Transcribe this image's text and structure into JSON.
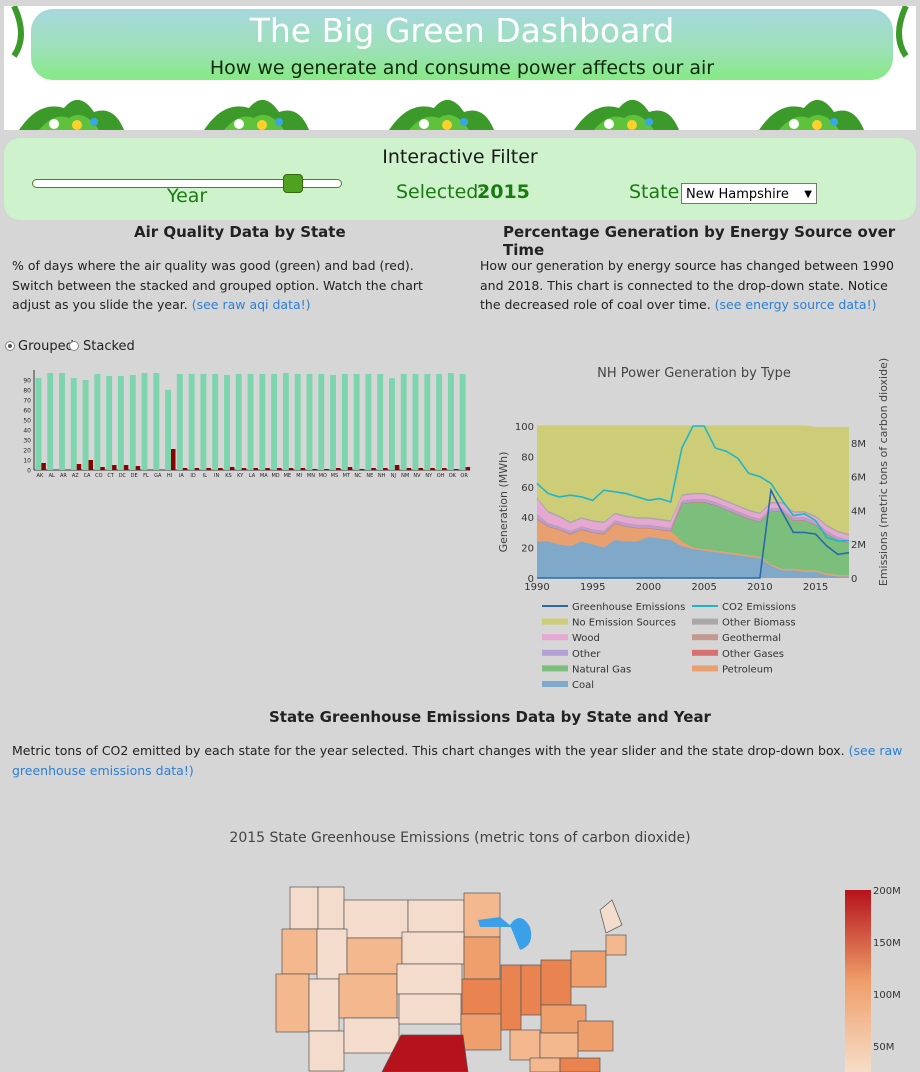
{
  "header": {
    "title": "The Big Green Dashboard",
    "subtitle": "How we generate and consume power affects our air"
  },
  "filter": {
    "title": "Interactive Filter",
    "slider_label": "Year",
    "slider_value": 2015,
    "slider_min": 1990,
    "slider_max": 2018,
    "selected_label": "Selected:",
    "selected_value": "2015",
    "state_label": "State:",
    "state_value": "New Hampshire"
  },
  "aqi": {
    "heading": "Air Quality Data by State",
    "description": "% of days where the air quality was good (green) and bad (red). Switch between the stacked and grouped option. Watch the chart adjust as you slide the year.",
    "link": "(see raw aqi data!)",
    "radio_grouped": "Grouped",
    "radio_stacked": "Stacked",
    "good_color": "#7dd5ad",
    "bad_color": "#8b0000"
  },
  "energy": {
    "heading": "Percentage Generation by Energy Source over Time",
    "description": "How our generation by energy source has changed between 1990 and 2018. This chart is connected to the drop-down state. Notice the decreased role of coal over time.",
    "link": "(see energy source data!)"
  },
  "emissions": {
    "heading": "State Greenhouse Emissions Data by State and Year",
    "description": "Metric tons of CO2 emitted by each state for the year selected. This chart changes with the year slider and the state drop-down box.",
    "link": "(see raw greenhouse emissions data!)"
  },
  "chart_data": [
    {
      "type": "bar",
      "title": "",
      "ylim": [
        0,
        100
      ],
      "yticks": [
        0,
        10,
        20,
        30,
        40,
        50,
        60,
        70,
        80,
        90
      ],
      "categories": [
        "AK",
        "AL",
        "AR",
        "AZ",
        "CA",
        "CO",
        "CT",
        "DC",
        "DE",
        "FL",
        "GA",
        "HI",
        "IA",
        "ID",
        "IL",
        "IN",
        "KS",
        "KY",
        "LA",
        "MA",
        "MD",
        "ME",
        "MI",
        "MN",
        "MO",
        "MS",
        "MT",
        "NC",
        "NE",
        "NH",
        "NJ",
        "NM",
        "NV",
        "NY",
        "OH",
        "OK",
        "OR"
      ],
      "series": [
        {
          "name": "",
          "color": "#7dd5ad",
          "values": [
            92,
            97,
            97,
            92,
            90,
            96,
            94,
            94,
            95,
            97,
            97,
            80,
            96,
            96,
            96,
            96,
            95,
            96,
            96,
            96,
            96,
            97,
            96,
            96,
            96,
            95,
            96,
            96,
            96,
            96,
            92,
            96,
            96,
            96,
            96,
            97,
            96
          ]
        },
        {
          "name": "",
          "color": "#8b0000",
          "values": [
            7,
            0,
            0,
            6,
            10,
            3,
            5,
            5,
            4,
            0,
            0,
            21,
            2,
            2,
            2,
            2,
            3,
            2,
            2,
            2,
            2,
            2,
            2,
            1,
            1,
            2,
            3,
            1,
            2,
            2,
            5,
            2,
            2,
            2,
            2,
            1,
            3
          ]
        }
      ]
    },
    {
      "type": "area",
      "title": "NH Power Generation by Type",
      "xlabel": "",
      "ylabel": "Generation (MWh)",
      "y2label": "Emissions (metric tons of carbon dioxide)",
      "xlim": [
        1990,
        2018
      ],
      "ylim": [
        0,
        100
      ],
      "y2lim": [
        0,
        9000000
      ],
      "xticks": [
        1990,
        1995,
        2000,
        2005,
        2010,
        2015
      ],
      "yticks": [
        0,
        20,
        40,
        60,
        80,
        100
      ],
      "y2ticks": [
        "0",
        "2M",
        "4M",
        "6M",
        "8M"
      ],
      "x": [
        1990,
        1991,
        1992,
        1993,
        1994,
        1995,
        1996,
        1997,
        1998,
        1999,
        2000,
        2001,
        2002,
        2003,
        2004,
        2005,
        2006,
        2007,
        2008,
        2009,
        2010,
        2011,
        2012,
        2013,
        2014,
        2015,
        2016,
        2017,
        2018
      ],
      "series": [
        {
          "name": "Coal",
          "color": "#7fa8c9",
          "values": [
            24,
            24,
            22,
            21,
            24,
            22,
            20,
            25,
            24,
            24,
            27,
            26,
            25,
            21,
            19,
            18,
            17,
            16,
            15,
            14,
            13,
            8,
            5,
            5,
            4,
            4,
            2,
            1,
            1
          ]
        },
        {
          "name": "Petroleum",
          "color": "#e8a070",
          "values": [
            15,
            10,
            10,
            8,
            8,
            8,
            9,
            11,
            10,
            9,
            6,
            6,
            6,
            3,
            1,
            1,
            1,
            1,
            1,
            1,
            1,
            1,
            1,
            1,
            1,
            1,
            1,
            1,
            1
          ]
        },
        {
          "name": "Natural Gas",
          "color": "#7cbf7c",
          "values": [
            0,
            0,
            0,
            0,
            0,
            0,
            0,
            0,
            0,
            0,
            0,
            0,
            0,
            25,
            30,
            31,
            30,
            28,
            26,
            24,
            23,
            35,
            38,
            32,
            33,
            30,
            26,
            23,
            21
          ]
        },
        {
          "name": "Other Gases",
          "color": "#d97070",
          "values": [
            0,
            0,
            0,
            0,
            0,
            0,
            0,
            0,
            0,
            0,
            0,
            0,
            0,
            0,
            0,
            0,
            0,
            0,
            0,
            0,
            0,
            0,
            0,
            0,
            0,
            0,
            0,
            0,
            0
          ]
        },
        {
          "name": "Other",
          "color": "#b4a0d4",
          "values": [
            3,
            2,
            2,
            2,
            2,
            2,
            2,
            2,
            2,
            2,
            2,
            2,
            2,
            2,
            2,
            2,
            2,
            2,
            2,
            2,
            2,
            2,
            2,
            2,
            2,
            2,
            2,
            2,
            2
          ]
        },
        {
          "name": "Geothermal",
          "color": "#c49a90",
          "values": [
            0,
            0,
            0,
            0,
            0,
            0,
            0,
            0,
            0,
            0,
            0,
            0,
            0,
            0,
            0,
            0,
            0,
            0,
            0,
            0,
            0,
            0,
            0,
            0,
            0,
            0,
            0,
            0,
            0
          ]
        },
        {
          "name": "Wood",
          "color": "#e6a8d2",
          "values": [
            10,
            7,
            6,
            5,
            5,
            5,
            5,
            4,
            4,
            4,
            4,
            4,
            4,
            3,
            3,
            3,
            3,
            3,
            3,
            3,
            3,
            3,
            3,
            3,
            3,
            3,
            3,
            3,
            3
          ]
        },
        {
          "name": "Other Biomass",
          "color": "#a8a8a8",
          "values": [
            1,
            1,
            1,
            1,
            1,
            1,
            1,
            1,
            1,
            1,
            1,
            1,
            1,
            1,
            1,
            1,
            1,
            1,
            1,
            1,
            1,
            1,
            1,
            1,
            1,
            1,
            1,
            1,
            1
          ]
        },
        {
          "name": "No Emission Sources",
          "color": "#cdcd78",
          "values": [
            47,
            56,
            59,
            63,
            60,
            62,
            63,
            57,
            59,
            60,
            60,
            61,
            62,
            45,
            44,
            44,
            46,
            49,
            52,
            55,
            57,
            50,
            50,
            56,
            56,
            58,
            64,
            68,
            70
          ]
        }
      ],
      "lines": [
        {
          "name": "Greenhouse Emissions",
          "color": "#2a6aa8",
          "values": [
            0,
            0,
            0,
            0,
            0,
            0,
            0,
            0,
            0,
            0,
            0,
            0,
            0,
            0,
            0,
            0,
            0,
            0,
            0,
            0,
            0,
            5200000,
            3900000,
            2700000,
            2700000,
            2600000,
            1900000,
            1400000,
            1500000
          ]
        },
        {
          "name": "CO2 Emissions",
          "color": "#1fb5c8",
          "values": [
            5600000,
            5000000,
            4800000,
            4900000,
            4800000,
            4600000,
            5200000,
            5100000,
            5000000,
            4800000,
            4600000,
            4700000,
            4500000,
            7700000,
            9000000,
            9000000,
            7700000,
            7500000,
            7100000,
            6200000,
            6000000,
            5600000,
            4600000,
            3700000,
            3800000,
            3400000,
            2400000,
            2200000,
            2200000
          ]
        }
      ],
      "legend": [
        "Greenhouse Emissions",
        "CO2 Emissions",
        "No Emission Sources",
        "Other Biomass",
        "Wood",
        "Geothermal",
        "Other",
        "Other Gases",
        "Natural Gas",
        "Petroleum",
        "Coal"
      ]
    },
    {
      "type": "choropleth",
      "title": "2015 State Greenhouse Emissions (metric tons of carbon dioxide)",
      "colorbar_ticks": [
        "200M",
        "150M",
        "100M",
        "50M"
      ],
      "color_low": "#f6ddc8",
      "color_high": "#b5121b"
    }
  ]
}
